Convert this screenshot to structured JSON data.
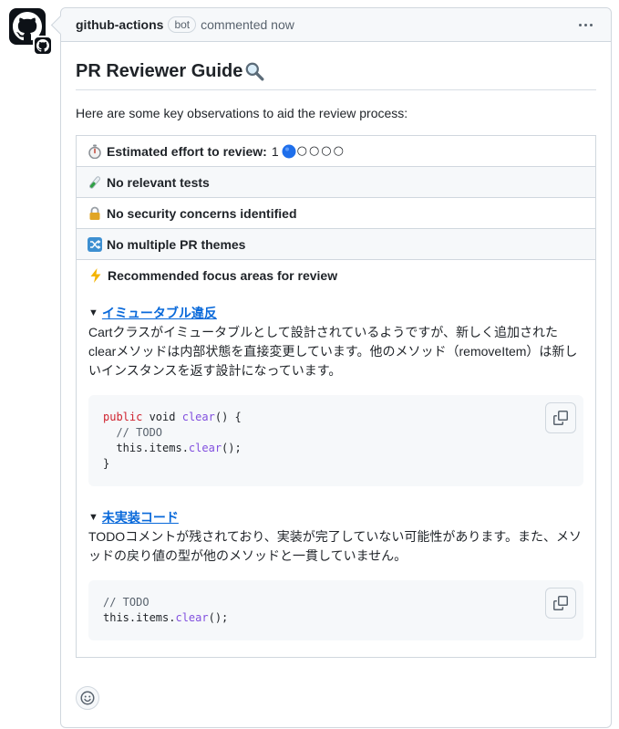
{
  "comment": {
    "author": "github-actions",
    "badge": "bot",
    "meta": "commented now"
  },
  "guide": {
    "title": "PR Reviewer Guide",
    "intro": "Here are some key observations to aid the review process:",
    "rows": {
      "effort_label": "Estimated effort to review:",
      "effort_value": "1",
      "effort_dots": "○○○○",
      "tests": "No relevant tests",
      "security": "No security concerns identified",
      "themes": "No multiple PR themes",
      "focus": "Recommended focus areas for review"
    },
    "focus_areas": [
      {
        "title": "イミュータブル違反",
        "description": "Cartクラスがイミュータブルとして設計されているようですが、新しく追加されたclearメソッドは内部状態を直接変更しています。他のメソッド（removeItem）は新しいインスタンスを返す設計になっています。",
        "code": {
          "kw": "public",
          "sig1": " void ",
          "fn1": "clear",
          "sig2": "() {",
          "comment": "  // TODO",
          "body_pre": "  this.items.",
          "body_fn": "clear",
          "body_post": "();",
          "close": "}"
        }
      },
      {
        "title": "未実装コード",
        "description": "TODOコメントが残されており、実装が完了していない可能性があります。また、メソッドの戻り値の型が他のメソッドと一貫していません。",
        "code": {
          "comment": "// TODO",
          "body_pre": "this.items.",
          "body_fn": "clear",
          "body_post": "();"
        }
      }
    ]
  },
  "icons": {
    "title_icon": "magnifier-icon",
    "effort_icon": "stopwatch-icon",
    "tests_icon": "test-tube-icon",
    "security_icon": "lock-icon",
    "themes_icon": "shuffle-icon",
    "focus_icon": "lightning-icon",
    "copy_icon": "copy-icon",
    "react_icon": "smiley-icon"
  },
  "colors": {
    "link": "#0969da",
    "keyword": "#cf222e",
    "function": "#8250df",
    "border": "#d0d7de",
    "effort_dot": "#1f6feb"
  }
}
